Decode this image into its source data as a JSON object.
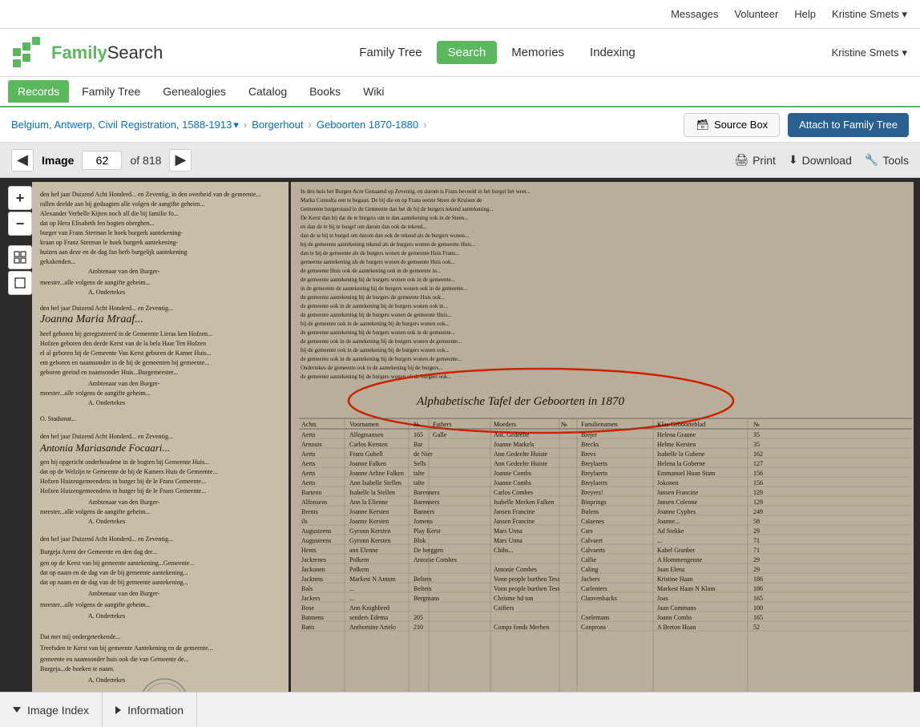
{
  "topbar": {
    "links": [
      "Messages",
      "Volunteer",
      "Help"
    ],
    "help_arrow": "▾",
    "user": "Kristine Smets",
    "user_arrow": "▾"
  },
  "header": {
    "logo_text1": "Family",
    "logo_text2": "Search",
    "nav": [
      {
        "label": "Family Tree",
        "active": false
      },
      {
        "label": "Search",
        "active": true
      },
      {
        "label": "Memories",
        "active": false
      },
      {
        "label": "Indexing",
        "active": false
      }
    ]
  },
  "subnav": {
    "items": [
      {
        "label": "Records",
        "active": true
      },
      {
        "label": "Family Tree",
        "active": false
      },
      {
        "label": "Genealogies",
        "active": false
      },
      {
        "label": "Catalog",
        "active": false
      },
      {
        "label": "Books",
        "active": false
      },
      {
        "label": "Wiki",
        "active": false
      }
    ]
  },
  "breadcrumb": {
    "collection": "Belgium, Antwerp, Civil Registration, 1588-1913",
    "location": "Borgerhout",
    "volume": "Geboorten 1870-1880",
    "dropdown_arrow": "▾",
    "chevron": "›"
  },
  "actions": {
    "source_box": "Source Box",
    "attach": "Attach to Family Tree",
    "source_box_icon": "📥"
  },
  "toolbar": {
    "image_label": "Image",
    "image_number": "62",
    "image_of": "of 818",
    "print": "Print",
    "download": "Download",
    "tools": "Tools",
    "print_icon": "🖨",
    "download_icon": "⬇",
    "tools_icon": "🔧"
  },
  "footer": {
    "image_index": "Image Index",
    "information": "Information"
  },
  "document": {
    "title_oval": "Alphabetische Tafel der Geboorten in 1870"
  }
}
